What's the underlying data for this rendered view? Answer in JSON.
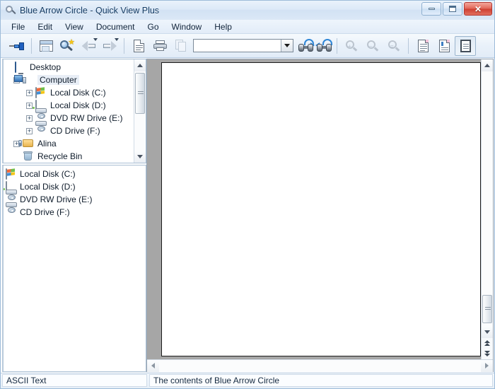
{
  "window": {
    "title": "Blue Arrow Circle - Quick View Plus",
    "app_icon": "magnifier-icon",
    "controls": {
      "minimize": "minimize-button",
      "maximize": "maximize-button",
      "close": "close-button"
    }
  },
  "menu": {
    "items": [
      {
        "label": "File"
      },
      {
        "label": "Edit"
      },
      {
        "label": "View"
      },
      {
        "label": "Document"
      },
      {
        "label": "Go"
      },
      {
        "label": "Window"
      },
      {
        "label": "Help"
      }
    ]
  },
  "toolbar": {
    "buttons": [
      {
        "name": "pin-toolbar-button",
        "icon": "pushpin-icon",
        "enabled": true
      },
      {
        "name": "window-view-button",
        "icon": "window-icon",
        "enabled": true
      },
      {
        "name": "find-file-button",
        "icon": "magnifier-star-icon",
        "enabled": true
      },
      {
        "name": "back-button",
        "icon": "arrow-left-icon",
        "enabled": true,
        "has_dropdown": true
      },
      {
        "name": "forward-button",
        "icon": "arrow-right-icon",
        "enabled": true,
        "has_dropdown": true
      },
      {
        "name": "new-document-button",
        "icon": "document-icon",
        "enabled": true
      },
      {
        "name": "print-button",
        "icon": "printer-icon",
        "enabled": true
      },
      {
        "name": "copy-button",
        "icon": "copy-pages-icon",
        "enabled": false
      },
      {
        "name": "find-next-button",
        "icon": "binoculars-next-icon",
        "enabled": true
      },
      {
        "name": "find-previous-button",
        "icon": "binoculars-previous-icon",
        "enabled": true
      },
      {
        "name": "zoom-in-button",
        "icon": "zoom-in-icon",
        "enabled": false
      },
      {
        "name": "zoom-out-button",
        "icon": "zoom-out-icon",
        "enabled": false
      },
      {
        "name": "zoom-fit-button",
        "icon": "zoom-fit-icon",
        "enabled": false
      },
      {
        "name": "page-layout-button",
        "icon": "page-plain-icon",
        "enabled": true
      },
      {
        "name": "page-draft-button",
        "icon": "page-marked-icon",
        "enabled": true
      },
      {
        "name": "page-full-button",
        "icon": "page-framed-icon",
        "enabled": true,
        "pressed": true
      }
    ],
    "search_combo": {
      "value": "",
      "placeholder": "",
      "dropdown_icon": "chevron-down-icon"
    }
  },
  "tree": {
    "items": [
      {
        "label": "Desktop",
        "icon": "desktop-icon",
        "indent": 0,
        "expander": "none",
        "selected": false
      },
      {
        "label": "Computer",
        "icon": "computer-icon",
        "indent": 1,
        "expander": "minus",
        "selected": true
      },
      {
        "label": "Local Disk (C:)",
        "icon": "hard-disk-system-icon",
        "indent": 2,
        "expander": "plus",
        "selected": false
      },
      {
        "label": "Local Disk (D:)",
        "icon": "hard-disk-icon",
        "indent": 2,
        "expander": "plus",
        "selected": false
      },
      {
        "label": "DVD RW Drive (E:)",
        "icon": "optical-drive-icon",
        "indent": 2,
        "expander": "plus",
        "selected": false
      },
      {
        "label": "CD Drive (F:)",
        "icon": "optical-drive-icon",
        "indent": 2,
        "expander": "plus",
        "selected": false
      },
      {
        "label": "Alina",
        "icon": "user-folder-icon",
        "indent": 1,
        "expander": "plus",
        "selected": false
      },
      {
        "label": "Recycle Bin",
        "icon": "recycle-bin-icon",
        "indent": 1,
        "expander": "none",
        "selected": false
      }
    ]
  },
  "file_list": {
    "items": [
      {
        "label": "Local Disk (C:)",
        "icon": "hard-disk-system-icon"
      },
      {
        "label": "Local Disk (D:)",
        "icon": "hard-disk-icon"
      },
      {
        "label": "DVD RW Drive (E:)",
        "icon": "optical-drive-icon"
      },
      {
        "label": "CD Drive (F:)",
        "icon": "optical-drive-icon"
      }
    ]
  },
  "document": {
    "page_content": "",
    "background_color": "#a6a6a6",
    "page_color": "#ffffff"
  },
  "statusbar": {
    "file_type": "ASCII Text",
    "description": "The contents of Blue Arrow Circle"
  }
}
